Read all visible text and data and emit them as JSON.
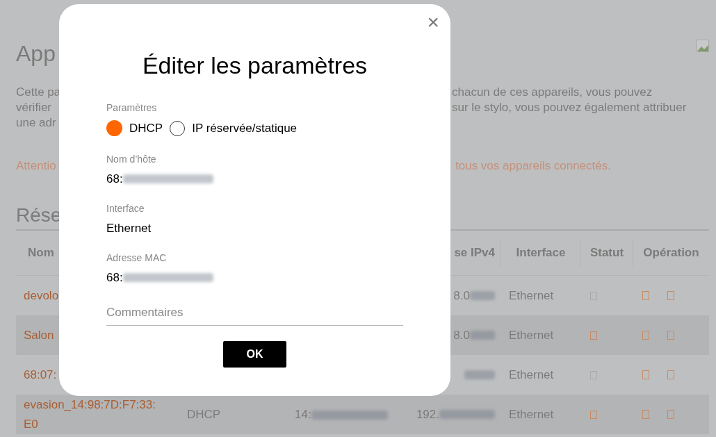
{
  "page": {
    "title": "App",
    "intro_lines": [
      {
        "left": "Cette pa",
        "right": "chacun de ces appareils, vous pouvez"
      },
      {
        "left": "vérifier",
        "right": "sur le stylo, vous pouvez également attribuer"
      },
      {
        "left": "une adr"
      }
    ],
    "warning": {
      "left": "Attentio",
      "right": "tous vos appareils connectés."
    },
    "section_title": "Rése"
  },
  "table": {
    "columns": {
      "column_1": "Nom",
      "column_4": "se IPv4",
      "column_5": "Interface",
      "column_6": "Statut",
      "column_7": "Opération"
    },
    "rows": [
      {
        "name": "devolo",
        "ipv4": {
          "text": "8.0",
          "blurred": true
        },
        "interface": "Ethernet",
        "color": "#a9aaab"
      },
      {
        "name": "Salon",
        "ipv4": {
          "text": "8.0",
          "blurred": true
        },
        "interface": "Ethernet",
        "color": "#c98a63"
      },
      {
        "name": "68:07:",
        "ipv4": {
          "blurred": true
        },
        "interface": "Ethernet",
        "color": "#a9aaab"
      },
      {
        "name": "evasion_14:98:7D:F7:33:E0",
        "column_2": "DHCP",
        "column_3": {
          "text": "14:",
          "blurred": true
        },
        "ipv4": {
          "text": "192.",
          "blurred": true
        },
        "interface": "Ethernet",
        "color": "#c98a63"
      }
    ]
  },
  "dialog": {
    "close": "×",
    "title": "Éditer les paramètres",
    "fields": [
      {
        "kind": "radio_group",
        "label": "Paramètres",
        "options": [
          {
            "label": "DHCP",
            "selected": true
          },
          {
            "label": "IP réservée/statique",
            "selected": false
          }
        ]
      },
      {
        "kind": "text",
        "label": "Nom d’hôte",
        "value": "68:",
        "blurred": true
      },
      {
        "kind": "text",
        "label": "Interface",
        "value": "Ethernet"
      },
      {
        "kind": "text",
        "label": "Adresse MAC",
        "value": "68:",
        "blurred": true
      },
      {
        "kind": "input",
        "placeholder": "Commentaires"
      }
    ],
    "ok": "OK"
  }
}
